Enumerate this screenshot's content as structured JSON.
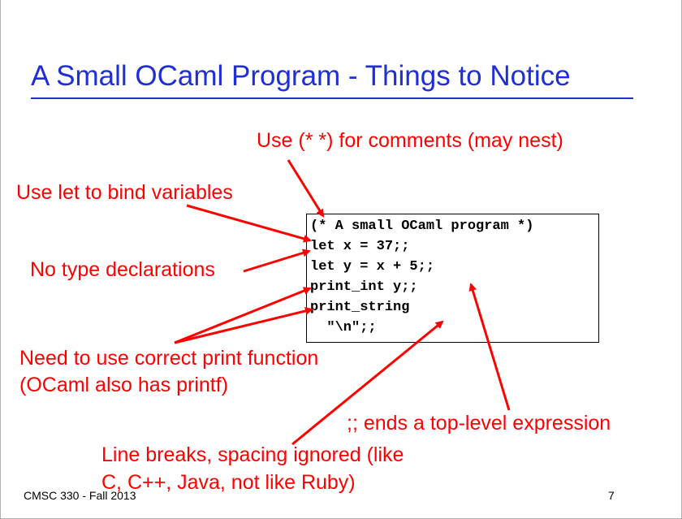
{
  "slide": {
    "title": "A Small OCaml Program - Things to Notice",
    "code_lines": [
      "(* A small OCaml program *)",
      "let x = 37;;",
      "let y = x + 5;;",
      "print_int y;;",
      "print_string",
      "  \"\\n\";;"
    ],
    "callouts": {
      "comments": "Use (* *) for comments (may nest)",
      "let_bind": "Use let to bind variables",
      "no_types": "No type declarations",
      "print_fn_line1": "Need to use correct print function",
      "print_fn_line2": "(OCaml also has printf)",
      "toplevel": ";; ends a top-level expression",
      "linebreaks_line1": "Line breaks, spacing ignored (like",
      "linebreaks_line2": "C, C++, Java, not like Ruby)"
    },
    "footer": "CMSC 330 - Fall 2013",
    "page_number": "7",
    "colors": {
      "title": "#1f2fd6",
      "rule": "#2233cc",
      "callout": "#ff0000",
      "code": "#000000"
    }
  }
}
